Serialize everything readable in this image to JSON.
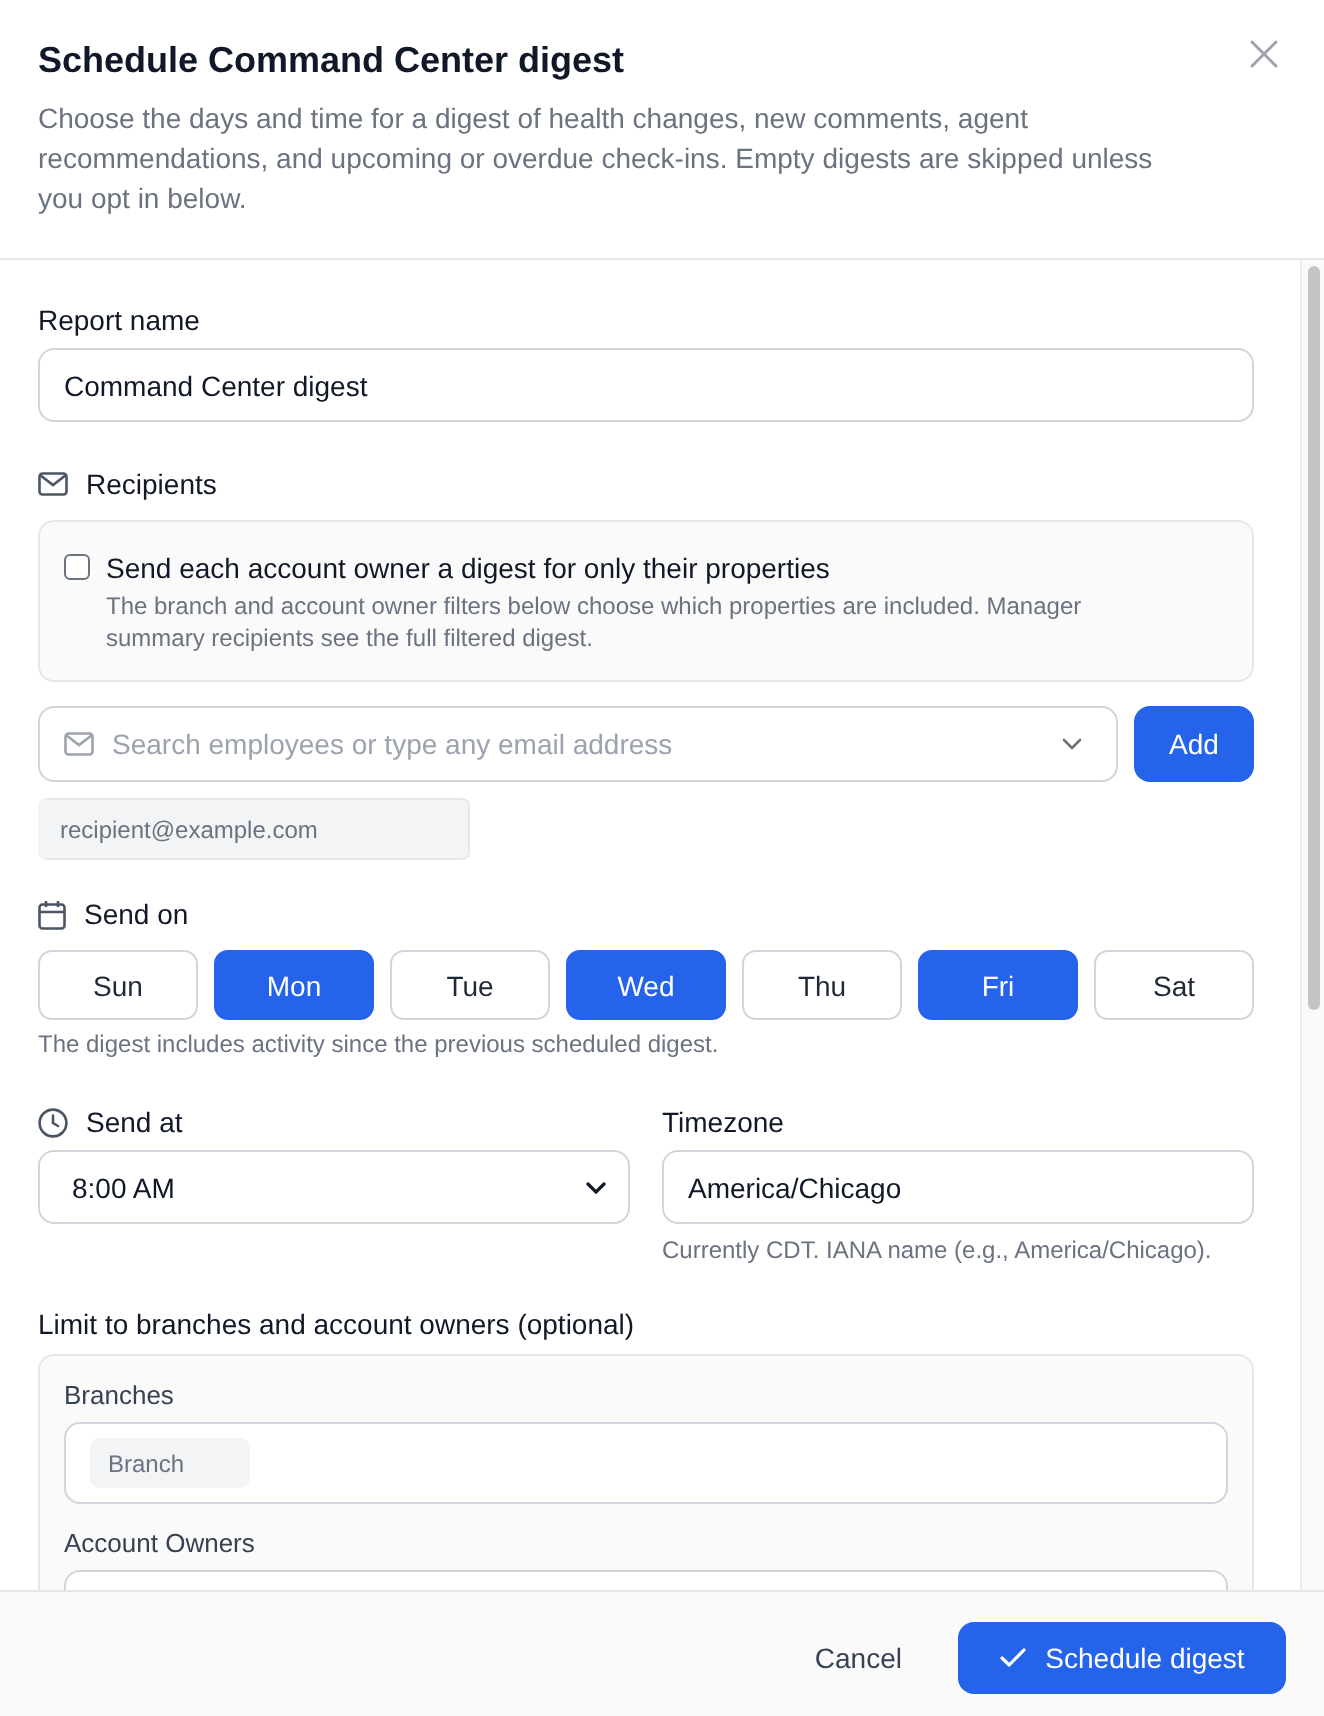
{
  "dialog": {
    "title": "Schedule Command Center digest",
    "description": "Choose the days and time for a digest of health changes, new comments, agent recommendations, and upcoming or overdue check-ins. Empty digests are skipped unless you opt in below."
  },
  "report_name": {
    "label": "Report name",
    "value": "Command Center digest"
  },
  "recipients": {
    "label": "Recipients",
    "per_owner_option": {
      "label": "Send each account owner a digest for only their properties",
      "help": "The branch and account owner filters below choose which properties are included. Manager summary recipients see the full filtered digest.",
      "checked": false
    },
    "search": {
      "placeholder": "Search employees or type any email address",
      "button": "Add"
    },
    "email_field": {
      "placeholder": "recipient@example.com"
    }
  },
  "send_on": {
    "label": "Send on",
    "days": [
      {
        "label": "Sun",
        "selected": false
      },
      {
        "label": "Mon",
        "selected": true
      },
      {
        "label": "Tue",
        "selected": false
      },
      {
        "label": "Wed",
        "selected": true
      },
      {
        "label": "Thu",
        "selected": false
      },
      {
        "label": "Fri",
        "selected": true
      },
      {
        "label": "Sat",
        "selected": false
      }
    ],
    "help": "The digest includes activity since the previous scheduled digest."
  },
  "send_at": {
    "label": "Send at",
    "value": "8:00 AM"
  },
  "timezone": {
    "label": "Timezone",
    "value": "America/Chicago",
    "help": "Currently CDT. IANA name (e.g., America/Chicago)."
  },
  "filters": {
    "label": "Limit to branches and account owners (optional)",
    "branches": {
      "label": "Branches",
      "placeholder": "Branch"
    },
    "account_owners": {
      "label": "Account Owners"
    }
  },
  "footer": {
    "buttons": [
      {
        "label": "Cancel",
        "kind": "secondary"
      },
      {
        "label": "Schedule digest",
        "kind": "primary"
      }
    ]
  }
}
